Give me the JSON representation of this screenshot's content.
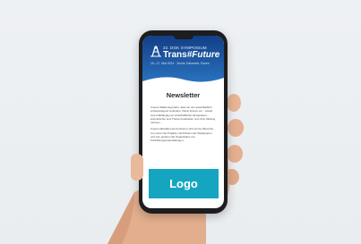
{
  "hero": {
    "edition": "22. DGK SYMPOSIUM",
    "title_part1": "Trans",
    "title_part2": "#Future",
    "dates": "15.–17. Mai 2024 · Zeche Zollverein, Essen"
  },
  "newsletter": {
    "title": "Newsletter",
    "paragraph1": "Unsere Städte liegt darin, dass wir uns ausschließlich schwerwiegend verändern. Damit können wir – visuell und unabhängig von wirtschaftlichen Ereignissen – kosmetischer eine Thesen bearbeiten und ohne Stellung nehmen.",
    "paragraph2": "Unsere Aktivitäten konzentrieren sich auf vier Bereiche zum einen die Projekte und Arbeiten der Stellgruppen und zum anderen die Organisation von Fortbildungsveranstaltungen."
  },
  "logo_button": {
    "label": "Logo"
  },
  "colors": {
    "hero_top": "#123f86",
    "hero_bottom": "#2c77c3",
    "logo_button": "#16a5c0"
  }
}
